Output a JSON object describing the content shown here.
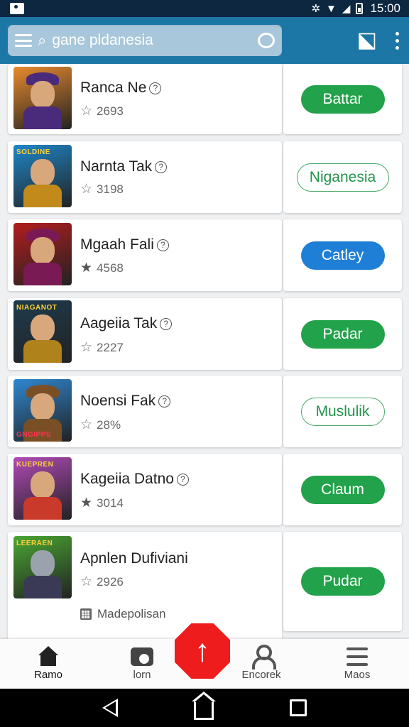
{
  "status_bar": {
    "time": "15:00",
    "icons": [
      "wifi-icon",
      "signal-icon",
      "battery-icon"
    ]
  },
  "app_bar": {
    "search_text": "gane pldanesia",
    "icons": [
      "menu-icon",
      "search-icon",
      "chat-icon",
      "share-icon",
      "more-icon"
    ]
  },
  "games": [
    {
      "title": "Ranca Ne",
      "rating": "2693",
      "button": "Battar",
      "button_style": "green",
      "thumb_bg": "#e88a2e",
      "accent": "#4a2a7a"
    },
    {
      "title": "Narnta Tak",
      "rating": "3198",
      "button": "Niganesia",
      "button_style": "outline",
      "thumb_bg": "#1e86c8",
      "accent": "#c28a1a",
      "logo": "SOLDINE"
    },
    {
      "title": "Mgaah Fali",
      "rating": "4568",
      "button": "Catley",
      "button_style": "blue",
      "thumb_bg": "#b21d1d",
      "accent": "#7a1a55"
    },
    {
      "title": "Aageiia Tak",
      "rating": "2227",
      "button": "Padar",
      "button_style": "green",
      "thumb_bg": "#1e3b4e",
      "accent": "#b0821c",
      "logo": "NIAGANOT"
    },
    {
      "title": "Noensi Fak",
      "rating": "28%",
      "button": "Muslulik",
      "button_style": "outline",
      "thumb_bg": "#2e87d0",
      "accent": "#7a4f26",
      "logo": "GNGIPPS"
    },
    {
      "title": "Kageiia Datno",
      "rating": "3014",
      "button": "Claum",
      "button_style": "green",
      "thumb_bg": "#b04ab6",
      "accent": "#c93a2a",
      "logo": "KUEPREN"
    },
    {
      "title": "Apnlen Dufiviani",
      "rating": "2926",
      "button": "Pudar",
      "button_style": "green",
      "thumb_bg": "#4aa632",
      "accent": "#3a3a56",
      "logo": "LEERAEN",
      "extra": "Madepolisan"
    }
  ],
  "bottom_nav": [
    {
      "label": "Ramo",
      "icon": "home-icon"
    },
    {
      "label": "lorn",
      "icon": "camera-icon"
    },
    {
      "label": "Encorek",
      "icon": "person-icon"
    },
    {
      "label": "Maos",
      "icon": "menu-icon"
    }
  ],
  "fab": {
    "icon": "arrow-up-icon",
    "color": "#ee1c1c"
  },
  "system_nav": [
    "back-icon",
    "home-icon",
    "recents-icon"
  ]
}
